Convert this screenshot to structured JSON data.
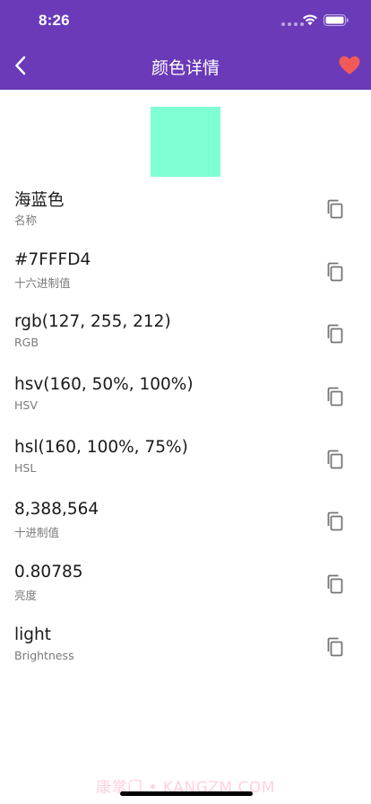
{
  "status_bar": {
    "time": "8:26"
  },
  "app_bar": {
    "title": "颜色详情",
    "back_icon": "chevron-left-icon",
    "favorite_icon": "heart-icon"
  },
  "colors": {
    "app_bar": "#6A3AB8",
    "swatch": "#7FFFD4",
    "favorite": "#F25A5A",
    "copy_icon": "#757575"
  },
  "details": [
    {
      "value": "海蓝色",
      "label": "名称"
    },
    {
      "value": "#7FFFD4",
      "label": "十六进制值"
    },
    {
      "value": "rgb(127, 255, 212)",
      "label": "RGB"
    },
    {
      "value": "hsv(160, 50%, 100%)",
      "label": "HSV"
    },
    {
      "value": "hsl(160, 100%, 75%)",
      "label": "HSL"
    },
    {
      "value": "8,388,564",
      "label": "十进制值"
    },
    {
      "value": "0.80785",
      "label": "亮度"
    },
    {
      "value": "light",
      "label": "Brightness"
    }
  ],
  "watermark": "康掌门 • KANGZM.COM"
}
